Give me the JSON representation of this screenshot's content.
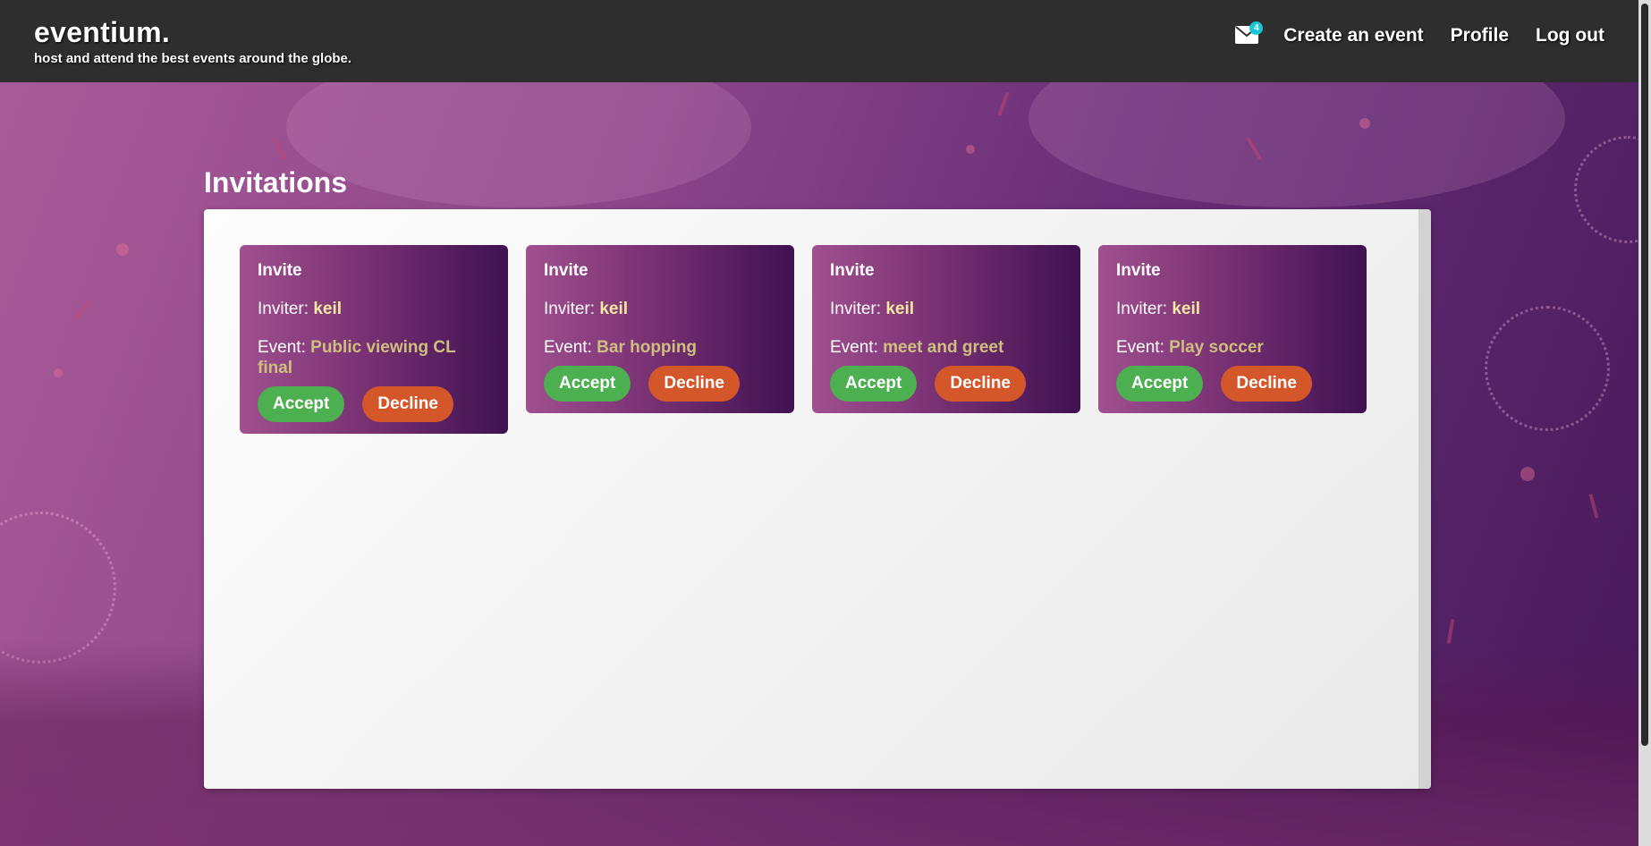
{
  "header": {
    "brand_title": "eventium.",
    "brand_subtitle": "host and attend the best events around the globe.",
    "mail_badge_count": "4",
    "mail_icon": "envelope-icon",
    "nav": {
      "create_event": "Create an event",
      "profile": "Profile",
      "logout": "Log out"
    }
  },
  "main": {
    "heading": "Invitations",
    "cards": [
      {
        "title": "Invite",
        "inviter_label": "Inviter:",
        "inviter": "keil",
        "event_label": "Event:",
        "event": "Public viewing CL final",
        "accept": "Accept",
        "decline": "Decline"
      },
      {
        "title": "Invite",
        "inviter_label": "Inviter:",
        "inviter": "keil",
        "event_label": "Event:",
        "event": "Bar hopping",
        "accept": "Accept",
        "decline": "Decline"
      },
      {
        "title": "Invite",
        "inviter_label": "Inviter:",
        "inviter": "keil",
        "event_label": "Event:",
        "event": "meet and greet",
        "accept": "Accept",
        "decline": "Decline"
      },
      {
        "title": "Invite",
        "inviter_label": "Inviter:",
        "inviter": "keil",
        "event_label": "Event:",
        "event": "Play soccer",
        "accept": "Accept",
        "decline": "Decline"
      }
    ]
  },
  "colors": {
    "accept": "#4caf50",
    "decline": "#d4572a",
    "topbar": "#2e2e2e",
    "badge": "#19c6d6"
  }
}
